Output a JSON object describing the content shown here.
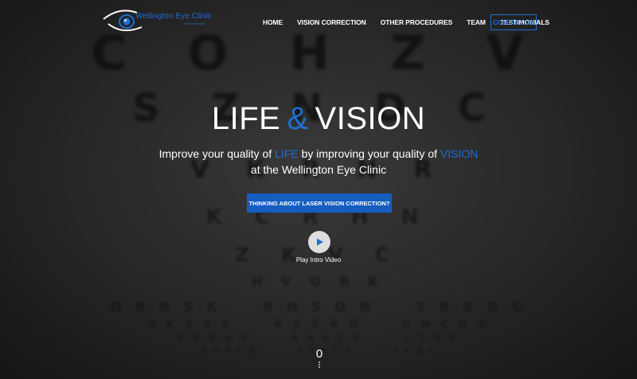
{
  "brand": {
    "name": "Wellington Eye Clinic",
    "subtitle": "Beacon Hospital"
  },
  "nav": {
    "items": [
      "HOME",
      "VISION CORRECTION",
      "OTHER PROCEDURES",
      "TEAM",
      "TESTIMONIALS"
    ],
    "contact_label": "CONTACT US"
  },
  "hero": {
    "title_left": "LIFE",
    "title_amp": "&",
    "title_right": "VISION",
    "tagline_part1": "Improve your quality of ",
    "tagline_hl1": "LIFE",
    "tagline_part2": " by improving your quality of ",
    "tagline_hl2": "VISION",
    "tagline_line2": "at the Wellington Eye Clinic",
    "cta_label": "THINKING ABOUT LASER VISION CORRECTION?",
    "play_label": "Play Intro Video",
    "scroll_indicator": "0"
  },
  "eye_chart": {
    "rows": [
      "C O H Z V",
      "S Z N D C",
      "V K R N R",
      "K C R H N",
      "Z K V C",
      "H V O R K"
    ],
    "small_rows": [
      [
        "D R N S K",
        "R H S O N",
        "Z R K D C"
      ],
      [
        "O K S V Z",
        "K S V R H",
        "D N C H V"
      ],
      [
        "K S N H O",
        "H N K C D",
        "C S N R"
      ],
      [
        "H O V S N",
        "R Z K C V",
        "Z K R V"
      ]
    ]
  },
  "colors": {
    "accent": "#1f6fd1",
    "cta_bg": "#155ec0",
    "background": "#2b2b2b"
  }
}
